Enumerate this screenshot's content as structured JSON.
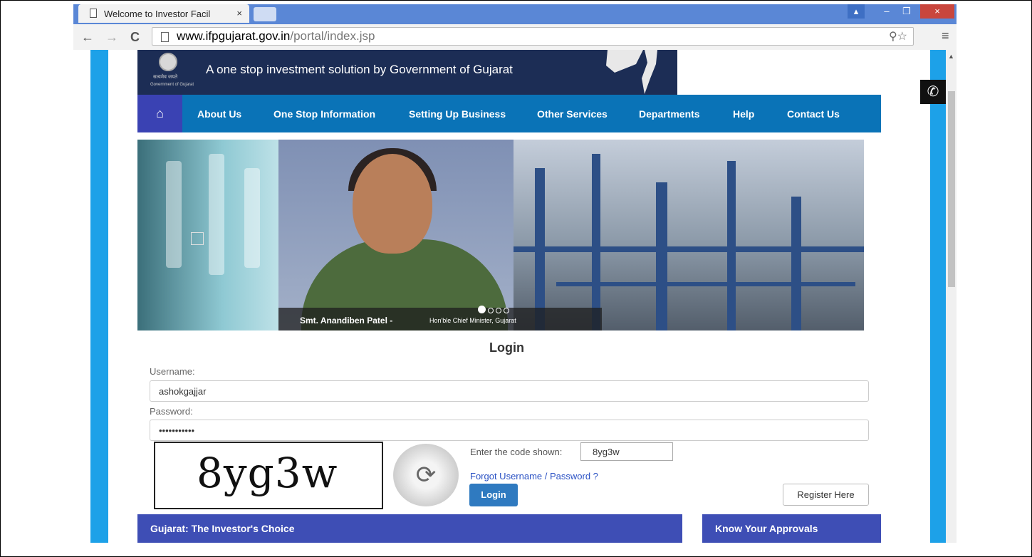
{
  "browser": {
    "tab_title": "Welcome to Investor Facil",
    "tab_close": "×",
    "url_domain": "www.ifpgujarat.gov.in",
    "url_path": "/portal/index.jsp",
    "back": "←",
    "forward": "→",
    "reload": "C",
    "zoom_star": "⚲☆",
    "menu": "≡",
    "win_user": "▴",
    "win_minimize": "–",
    "win_restore": "❐",
    "win_close": "×"
  },
  "header": {
    "tagline": "A one stop investment solution by Government of Gujarat",
    "emblem_text": "सत्यमेव जयते",
    "emblem_sub": "Government of Gujarat"
  },
  "nav": {
    "home_icon": "⌂",
    "items": [
      "About Us",
      "One Stop Information",
      "Setting Up Business",
      "Other Services",
      "Departments",
      "Help",
      "Contact Us"
    ]
  },
  "banner": {
    "caption_name": "Smt. Anandiben Patel -",
    "caption_role": "Hon'ble Chief Minister, Gujarat",
    "slide_count": 4,
    "active_slide": 1
  },
  "login": {
    "title": "Login",
    "username_label": "Username:",
    "username_value": "ashokgajjar",
    "password_label": "Password:",
    "password_value": "•••••••••••",
    "captcha_text": "8yg3w",
    "refresh_icon": "⟳",
    "code_label": "Enter the code shown:",
    "code_value": "8yg3w",
    "forgot_link": "Forgot Username / Password ?",
    "login_button": "Login",
    "register_button": "Register Here"
  },
  "panels": {
    "left_title": "Gujarat: The Investor's Choice",
    "right_title": "Know Your Approvals"
  },
  "floating": {
    "phone_icon": "✆"
  },
  "colors": {
    "nav_bg": "#0a73b7",
    "nav_home_bg": "#3a42b3",
    "header_bg": "#1c2d55",
    "side_bars": "#1da1e8",
    "panel_bg": "#3e4eb5",
    "login_button": "#2f7ac0"
  }
}
